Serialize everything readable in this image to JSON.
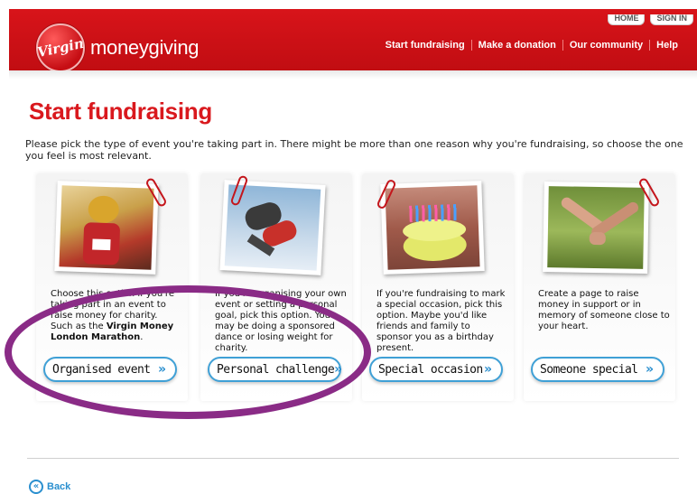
{
  "colors": {
    "brand_red": "#d9181d",
    "accent_blue": "#2a8fcf",
    "annotation_purple": "#8a2b86"
  },
  "header": {
    "util_links": [
      "HOME",
      "SIGN IN"
    ],
    "logo_badge": "Virgin",
    "logo_text": "moneygiving",
    "nav": [
      "Start fundraising",
      "Make a donation",
      "Our community",
      "Help"
    ]
  },
  "page": {
    "title": "Start fundraising",
    "intro": "Please pick the type of event you're taking part in. There might be more than one reason why you're fundraising, so choose the one you feel is most relevant."
  },
  "cards": [
    {
      "photo": "mascot-runner-photo",
      "text_pre": "Choose this option if you're taking part in an event to raise money for charity. Such as the ",
      "text_bold": "Virgin Money London Marathon",
      "text_post": ".",
      "button": "Organised event",
      "button_icon": "double-chevron-right-icon"
    },
    {
      "photo": "skydivers-photo",
      "text_pre": "If you're organising your own event or setting a personal goal, pick this option. You may be doing a sponsored dance or losing weight for charity.",
      "text_bold": "",
      "text_post": "",
      "button": "Personal challenge",
      "button_icon": "double-chevron-right-icon"
    },
    {
      "photo": "birthday-cake-photo",
      "text_pre": "If you're fundraising to mark a special occasion, pick this option. Maybe you'd like friends and family to sponsor you as a birthday present.",
      "text_bold": "",
      "text_post": "",
      "button": "Special occasion",
      "button_icon": "double-chevron-right-icon"
    },
    {
      "photo": "holding-hands-photo",
      "text_pre": "Create a page to raise money in support or in memory of someone close to your heart.",
      "text_bold": "",
      "text_post": "",
      "button": "Someone special",
      "button_icon": "double-chevron-right-icon"
    }
  ],
  "footer": {
    "back_label": "Back",
    "back_icon": "double-chevron-left-icon"
  }
}
